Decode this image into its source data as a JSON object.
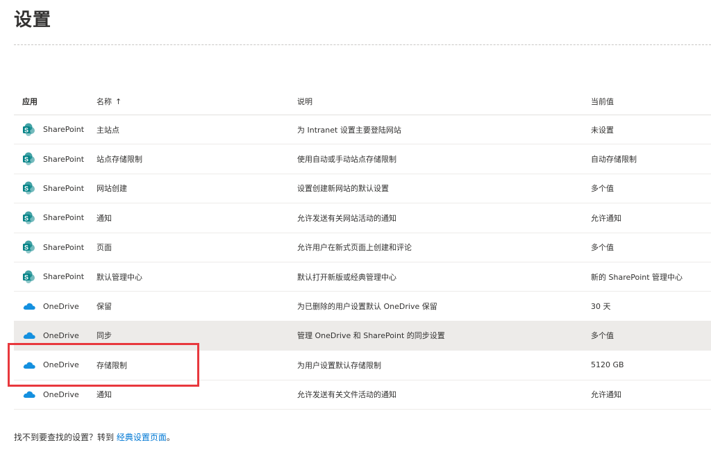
{
  "page": {
    "title": "设置"
  },
  "table": {
    "headers": {
      "app": "应用",
      "name": "名称",
      "sort_indicator": "↑",
      "description": "说明",
      "value": "当前值"
    },
    "rows": [
      {
        "app": "SharePoint",
        "icon": "sharepoint-icon",
        "name": "主站点",
        "description": "为 Intranet 设置主要登陆网站",
        "value": "未设置"
      },
      {
        "app": "SharePoint",
        "icon": "sharepoint-icon",
        "name": "站点存储限制",
        "description": "使用自动或手动站点存储限制",
        "value": "自动存储限制"
      },
      {
        "app": "SharePoint",
        "icon": "sharepoint-icon",
        "name": "网站创建",
        "description": "设置创建新网站的默认设置",
        "value": "多个值"
      },
      {
        "app": "SharePoint",
        "icon": "sharepoint-icon",
        "name": "通知",
        "description": "允许发送有关网站活动的通知",
        "value": "允许通知"
      },
      {
        "app": "SharePoint",
        "icon": "sharepoint-icon",
        "name": "页面",
        "description": "允许用户在新式页面上创建和评论",
        "value": "多个值"
      },
      {
        "app": "SharePoint",
        "icon": "sharepoint-icon",
        "name": "默认管理中心",
        "description": "默认打开新版或经典管理中心",
        "value": "新的 SharePoint 管理中心"
      },
      {
        "app": "OneDrive",
        "icon": "onedrive-icon",
        "name": "保留",
        "description": "为已删除的用户设置默认 OneDrive 保留",
        "value": "30 天"
      },
      {
        "app": "OneDrive",
        "icon": "onedrive-icon",
        "name": "同步",
        "description": "管理 OneDrive 和 SharePoint 的同步设置",
        "value": "多个值"
      },
      {
        "app": "OneDrive",
        "icon": "onedrive-icon",
        "name": "存储限制",
        "description": "为用户设置默认存储限制",
        "value": "5120 GB"
      },
      {
        "app": "OneDrive",
        "icon": "onedrive-icon",
        "name": "通知",
        "description": "允许发送有关文件活动的通知",
        "value": "允许通知"
      }
    ]
  },
  "footer": {
    "text": "找不到要查找的设置？转到 ",
    "link": "经典设置页面",
    "suffix": "。"
  },
  "colors": {
    "sharepoint": "#038387",
    "onedrive": "#1490df",
    "link": "#0078d4",
    "highlight": "#e8383d",
    "selected_row": "#edebe9"
  }
}
